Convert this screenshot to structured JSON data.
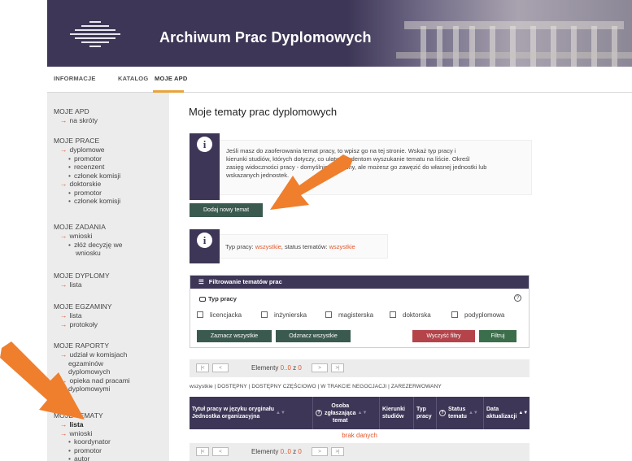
{
  "app": {
    "title": "Archiwum Prac Dyplomowych"
  },
  "topnav": {
    "tabs": [
      "INFORMACJE",
      "KATALOG",
      "MOJE APD"
    ],
    "active_index": 2
  },
  "sidebar": {
    "sections": [
      {
        "heading": "MOJE APD",
        "items": [
          "na skróty"
        ]
      },
      {
        "heading": "MOJE PRACE",
        "groups": [
          {
            "label": "dyplomowe",
            "subs": [
              "promotor",
              "recenzent",
              "członek komisji"
            ]
          },
          {
            "label": "doktorskie",
            "subs": [
              "promotor",
              "członek komisji"
            ]
          }
        ]
      },
      {
        "heading": "MOJE ZADANIA",
        "groups": [
          {
            "label": "wnioski",
            "subs": [
              "złóż decyzję we",
              "wniosku"
            ]
          }
        ]
      },
      {
        "heading": "MOJE DYPLOMY",
        "items": [
          "lista"
        ]
      },
      {
        "heading": "MOJE EGZAMINY",
        "items": [
          "lista",
          "protokoły"
        ]
      },
      {
        "heading": "MOJE RAPORTY",
        "items": [
          "udział w komisjach",
          "egzaminów",
          "dyplomowych",
          "opieka nad pracami",
          "dyplomowymi"
        ]
      },
      {
        "heading": "MOJE TEMATY",
        "items": [
          "lista",
          "wnioski"
        ],
        "subs": [
          "koordynator",
          "promotor",
          "autor"
        ]
      }
    ]
  },
  "main": {
    "page_title": "Moje tematy prac dyplomowych",
    "info_text_1": "Jeśli masz do zaoferowania temat pracy, to wpisz go na tej stronie. Wskaż typ pracy i kierunki studiów, których dotyczy, co ułatwi studentom wyszukanie tematu na liście. Określ zasięg widoczności pracy — domyślnie jest ogólnodostępna, ale w razie potrzeby możesz go zawęzić do własnej jednostki lub wskazanych jednostek.",
    "info_lines_1": [
      "Jeśli masz do zaoferowania temat pracy, to wpisz go na tej stronie. Wskaż typ pracy i",
      "kierunki studiów, których dotyczy, co ułatwi studentom wyszukanie tematu na liście. Określ",
      "zasięg widoczności pracy - domyślnie publiczny, ale możesz go zawęzić do własnej jednostki lub",
      "wskazanych jednostek."
    ],
    "add_button": "Dodaj nowy temat",
    "info_2": {
      "prefix": "Typ pracy: ",
      "type_value": "wszystkie",
      "middle": ", status tematów: ",
      "status_value": "wszystkie"
    },
    "filter": {
      "title": "Filtrowanie tematów prac",
      "type_label": "Typ pracy",
      "checkboxes": [
        "licencjacka",
        "inżynierska",
        "magisterska",
        "doktorska",
        "podyplomowa"
      ],
      "select_all": "Zaznacz wszystkie",
      "deselect_all": "Odznacz wszystkie",
      "clear": "Wyczyść filtry",
      "apply": "Filtruj"
    },
    "pager": {
      "label": "Elementy",
      "from": "0..0",
      "of_word": "z",
      "total": "0"
    },
    "status_filters": "wszystkie | DOSTĘPNY | DOSTĘPNY CZĘŚCIOWO | W TRAKCIE NEGOCJACJI | ZAREZERWOWANY",
    "table": {
      "col1_line1": "Tytuł pracy w języku oryginału",
      "col1_line2": "Jednostka organizacyjna",
      "col2_line1": "Osoba",
      "col2_line2": "zgłaszająca",
      "col2_line3": "temat",
      "col3_line1": "Kierunki",
      "col3_line2": "studiów",
      "col4_line1": "Typ",
      "col4_line2": "pracy",
      "col5_line1": "Status",
      "col5_line2": "tematu",
      "col6_line1": "Data",
      "col6_line2": "aktualizacji",
      "empty": "brak danych"
    }
  },
  "colors": {
    "brand": "#3d3656",
    "accent": "#e4562c",
    "button_green": "#3b5a4f",
    "danger": "#b4434a"
  }
}
